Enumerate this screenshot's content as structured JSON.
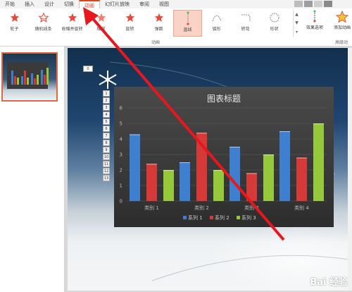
{
  "tabs": [
    {
      "label": "开始"
    },
    {
      "label": "插入"
    },
    {
      "label": "设计"
    },
    {
      "label": "切换"
    },
    {
      "label": "动画",
      "active": true
    },
    {
      "label": "幻灯片放映"
    },
    {
      "label": "审阅"
    },
    {
      "label": "视图"
    }
  ],
  "ribbon": {
    "effects": [
      {
        "label": "轮子",
        "icon": "star-icon"
      },
      {
        "label": "随机线条",
        "icon": "star-icon"
      },
      {
        "label": "收缩并旋转",
        "icon": "star-icon"
      },
      {
        "label": "缩放",
        "icon": "star-icon"
      },
      {
        "label": "旋转",
        "icon": "star-icon"
      },
      {
        "label": "弹跳",
        "icon": "star-icon"
      },
      {
        "label": "直线",
        "icon": "line-path-icon",
        "selected": true
      },
      {
        "label": "弧形",
        "icon": "arc-path-icon"
      },
      {
        "label": "转弯",
        "icon": "turn-path-icon"
      },
      {
        "label": "形状",
        "icon": "circle-path-icon"
      }
    ],
    "effect_options_label": "效果选项",
    "add_animation_label": "添加动画",
    "group_animation_label": "动画",
    "group_advanced_label": "高级动"
  },
  "slide": {
    "placeholder_tag": "0",
    "number_badges": [
      "1",
      "2",
      "3",
      "4",
      "5",
      "6",
      "7",
      "8",
      "9",
      "10",
      "11",
      "12",
      "13"
    ]
  },
  "chart_data": {
    "type": "bar",
    "title": "图表标题",
    "categories": [
      "类别 1",
      "类别 2",
      "类别 3",
      "类别 4"
    ],
    "series": [
      {
        "name": "系列 1",
        "values": [
          4.3,
          2.5,
          3.5,
          4.5
        ],
        "color": "#3e7fd0"
      },
      {
        "name": "系列 2",
        "values": [
          2.4,
          4.4,
          1.8,
          2.8
        ],
        "color": "#d63a38"
      },
      {
        "name": "系列 3",
        "values": [
          2.0,
          2.0,
          3.0,
          5.0
        ],
        "color": "#96c83c"
      }
    ],
    "ylim": [
      0,
      6
    ],
    "yticks": [
      "0",
      "1",
      "2",
      "3",
      "4",
      "5",
      "6"
    ],
    "legend_position": "bottom",
    "grid": true
  },
  "watermark": "Bai 经验",
  "colors": {
    "accent": "#d24726",
    "arrow": "#e8161d"
  }
}
